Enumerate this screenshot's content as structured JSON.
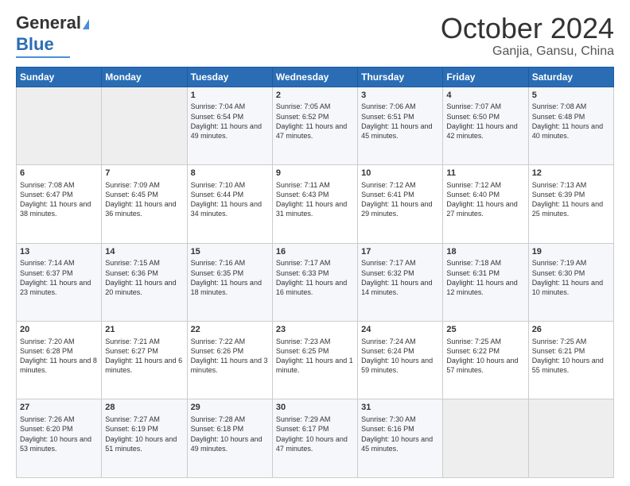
{
  "header": {
    "logo_line1": "General",
    "logo_line2": "Blue",
    "title": "October 2024",
    "subtitle": "Ganjia, Gansu, China"
  },
  "columns": [
    "Sunday",
    "Monday",
    "Tuesday",
    "Wednesday",
    "Thursday",
    "Friday",
    "Saturday"
  ],
  "weeks": [
    [
      {
        "day": "",
        "sunrise": "",
        "sunset": "",
        "daylight": ""
      },
      {
        "day": "",
        "sunrise": "",
        "sunset": "",
        "daylight": ""
      },
      {
        "day": "1",
        "sunrise": "Sunrise: 7:04 AM",
        "sunset": "Sunset: 6:54 PM",
        "daylight": "Daylight: 11 hours and 49 minutes."
      },
      {
        "day": "2",
        "sunrise": "Sunrise: 7:05 AM",
        "sunset": "Sunset: 6:52 PM",
        "daylight": "Daylight: 11 hours and 47 minutes."
      },
      {
        "day": "3",
        "sunrise": "Sunrise: 7:06 AM",
        "sunset": "Sunset: 6:51 PM",
        "daylight": "Daylight: 11 hours and 45 minutes."
      },
      {
        "day": "4",
        "sunrise": "Sunrise: 7:07 AM",
        "sunset": "Sunset: 6:50 PM",
        "daylight": "Daylight: 11 hours and 42 minutes."
      },
      {
        "day": "5",
        "sunrise": "Sunrise: 7:08 AM",
        "sunset": "Sunset: 6:48 PM",
        "daylight": "Daylight: 11 hours and 40 minutes."
      }
    ],
    [
      {
        "day": "6",
        "sunrise": "Sunrise: 7:08 AM",
        "sunset": "Sunset: 6:47 PM",
        "daylight": "Daylight: 11 hours and 38 minutes."
      },
      {
        "day": "7",
        "sunrise": "Sunrise: 7:09 AM",
        "sunset": "Sunset: 6:45 PM",
        "daylight": "Daylight: 11 hours and 36 minutes."
      },
      {
        "day": "8",
        "sunrise": "Sunrise: 7:10 AM",
        "sunset": "Sunset: 6:44 PM",
        "daylight": "Daylight: 11 hours and 34 minutes."
      },
      {
        "day": "9",
        "sunrise": "Sunrise: 7:11 AM",
        "sunset": "Sunset: 6:43 PM",
        "daylight": "Daylight: 11 hours and 31 minutes."
      },
      {
        "day": "10",
        "sunrise": "Sunrise: 7:12 AM",
        "sunset": "Sunset: 6:41 PM",
        "daylight": "Daylight: 11 hours and 29 minutes."
      },
      {
        "day": "11",
        "sunrise": "Sunrise: 7:12 AM",
        "sunset": "Sunset: 6:40 PM",
        "daylight": "Daylight: 11 hours and 27 minutes."
      },
      {
        "day": "12",
        "sunrise": "Sunrise: 7:13 AM",
        "sunset": "Sunset: 6:39 PM",
        "daylight": "Daylight: 11 hours and 25 minutes."
      }
    ],
    [
      {
        "day": "13",
        "sunrise": "Sunrise: 7:14 AM",
        "sunset": "Sunset: 6:37 PM",
        "daylight": "Daylight: 11 hours and 23 minutes."
      },
      {
        "day": "14",
        "sunrise": "Sunrise: 7:15 AM",
        "sunset": "Sunset: 6:36 PM",
        "daylight": "Daylight: 11 hours and 20 minutes."
      },
      {
        "day": "15",
        "sunrise": "Sunrise: 7:16 AM",
        "sunset": "Sunset: 6:35 PM",
        "daylight": "Daylight: 11 hours and 18 minutes."
      },
      {
        "day": "16",
        "sunrise": "Sunrise: 7:17 AM",
        "sunset": "Sunset: 6:33 PM",
        "daylight": "Daylight: 11 hours and 16 minutes."
      },
      {
        "day": "17",
        "sunrise": "Sunrise: 7:17 AM",
        "sunset": "Sunset: 6:32 PM",
        "daylight": "Daylight: 11 hours and 14 minutes."
      },
      {
        "day": "18",
        "sunrise": "Sunrise: 7:18 AM",
        "sunset": "Sunset: 6:31 PM",
        "daylight": "Daylight: 11 hours and 12 minutes."
      },
      {
        "day": "19",
        "sunrise": "Sunrise: 7:19 AM",
        "sunset": "Sunset: 6:30 PM",
        "daylight": "Daylight: 11 hours and 10 minutes."
      }
    ],
    [
      {
        "day": "20",
        "sunrise": "Sunrise: 7:20 AM",
        "sunset": "Sunset: 6:28 PM",
        "daylight": "Daylight: 11 hours and 8 minutes."
      },
      {
        "day": "21",
        "sunrise": "Sunrise: 7:21 AM",
        "sunset": "Sunset: 6:27 PM",
        "daylight": "Daylight: 11 hours and 6 minutes."
      },
      {
        "day": "22",
        "sunrise": "Sunrise: 7:22 AM",
        "sunset": "Sunset: 6:26 PM",
        "daylight": "Daylight: 11 hours and 3 minutes."
      },
      {
        "day": "23",
        "sunrise": "Sunrise: 7:23 AM",
        "sunset": "Sunset: 6:25 PM",
        "daylight": "Daylight: 11 hours and 1 minute."
      },
      {
        "day": "24",
        "sunrise": "Sunrise: 7:24 AM",
        "sunset": "Sunset: 6:24 PM",
        "daylight": "Daylight: 10 hours and 59 minutes."
      },
      {
        "day": "25",
        "sunrise": "Sunrise: 7:25 AM",
        "sunset": "Sunset: 6:22 PM",
        "daylight": "Daylight: 10 hours and 57 minutes."
      },
      {
        "day": "26",
        "sunrise": "Sunrise: 7:25 AM",
        "sunset": "Sunset: 6:21 PM",
        "daylight": "Daylight: 10 hours and 55 minutes."
      }
    ],
    [
      {
        "day": "27",
        "sunrise": "Sunrise: 7:26 AM",
        "sunset": "Sunset: 6:20 PM",
        "daylight": "Daylight: 10 hours and 53 minutes."
      },
      {
        "day": "28",
        "sunrise": "Sunrise: 7:27 AM",
        "sunset": "Sunset: 6:19 PM",
        "daylight": "Daylight: 10 hours and 51 minutes."
      },
      {
        "day": "29",
        "sunrise": "Sunrise: 7:28 AM",
        "sunset": "Sunset: 6:18 PM",
        "daylight": "Daylight: 10 hours and 49 minutes."
      },
      {
        "day": "30",
        "sunrise": "Sunrise: 7:29 AM",
        "sunset": "Sunset: 6:17 PM",
        "daylight": "Daylight: 10 hours and 47 minutes."
      },
      {
        "day": "31",
        "sunrise": "Sunrise: 7:30 AM",
        "sunset": "Sunset: 6:16 PM",
        "daylight": "Daylight: 10 hours and 45 minutes."
      },
      {
        "day": "",
        "sunrise": "",
        "sunset": "",
        "daylight": ""
      },
      {
        "day": "",
        "sunrise": "",
        "sunset": "",
        "daylight": ""
      }
    ]
  ]
}
